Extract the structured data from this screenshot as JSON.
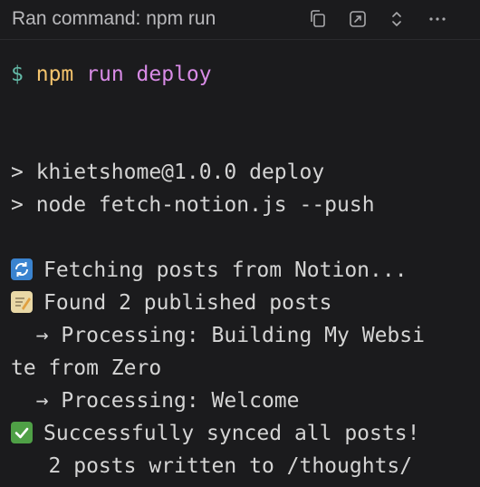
{
  "header": {
    "title": "Ran command: npm run",
    "icons": [
      "copy-icon",
      "open-external-icon",
      "expand-collapse-icon",
      "more-icon"
    ]
  },
  "terminal": {
    "prompt_symbol": "$",
    "cmd_npm": "npm",
    "cmd_run": "run",
    "cmd_deploy": "deploy",
    "line_script": "> khietshome@1.0.0 deploy",
    "line_node": "> node fetch-notion.js --push",
    "fetching": "Fetching posts from Notion...",
    "found": "Found 2 published posts",
    "processing_1a": "  → Processing: Building My Websi",
    "processing_1b": "te from Zero",
    "processing_2": "  → Processing: Welcome",
    "success": "Successfully synced all posts!",
    "written": "   2 posts written to /thoughts/"
  },
  "colors": {
    "background": "#1b1b1d",
    "prompt": "#63b8a6",
    "command": "#f4c46d",
    "argument": "#d88be6",
    "text": "#d4d4d4"
  }
}
